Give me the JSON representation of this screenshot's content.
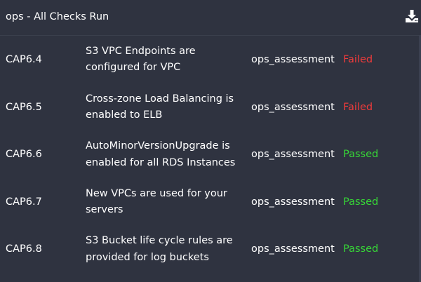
{
  "header": {
    "title": "ops - All Checks Run",
    "download_icon": "download-icon"
  },
  "colors": {
    "background": "#2f3340",
    "failed": "#ef3b3b",
    "passed": "#37d637"
  },
  "rows": [
    {
      "id": "CAP6.4",
      "desc_line1": "S3 VPC Endpoints are",
      "desc_line2": "configured for VPC",
      "assessment": "ops_assessment",
      "status": "Failed"
    },
    {
      "id": "CAP6.5",
      "desc_line1": "Cross-zone Load Balancing is",
      "desc_line2": "enabled to ELB",
      "assessment": "ops_assessment",
      "status": "Failed"
    },
    {
      "id": "CAP6.6",
      "desc_line1": "AutoMinorVersionUpgrade is",
      "desc_line2": "enabled for all RDS Instances",
      "assessment": "ops_assessment",
      "status": "Passed"
    },
    {
      "id": "CAP6.7",
      "desc_line1": "New VPCs are used for your",
      "desc_line2": "servers",
      "assessment": "ops_assessment",
      "status": "Passed"
    },
    {
      "id": "CAP6.8",
      "desc_line1": "S3 Bucket life cycle rules are",
      "desc_line2": "provided for log buckets",
      "assessment": "ops_assessment",
      "status": "Passed"
    }
  ]
}
